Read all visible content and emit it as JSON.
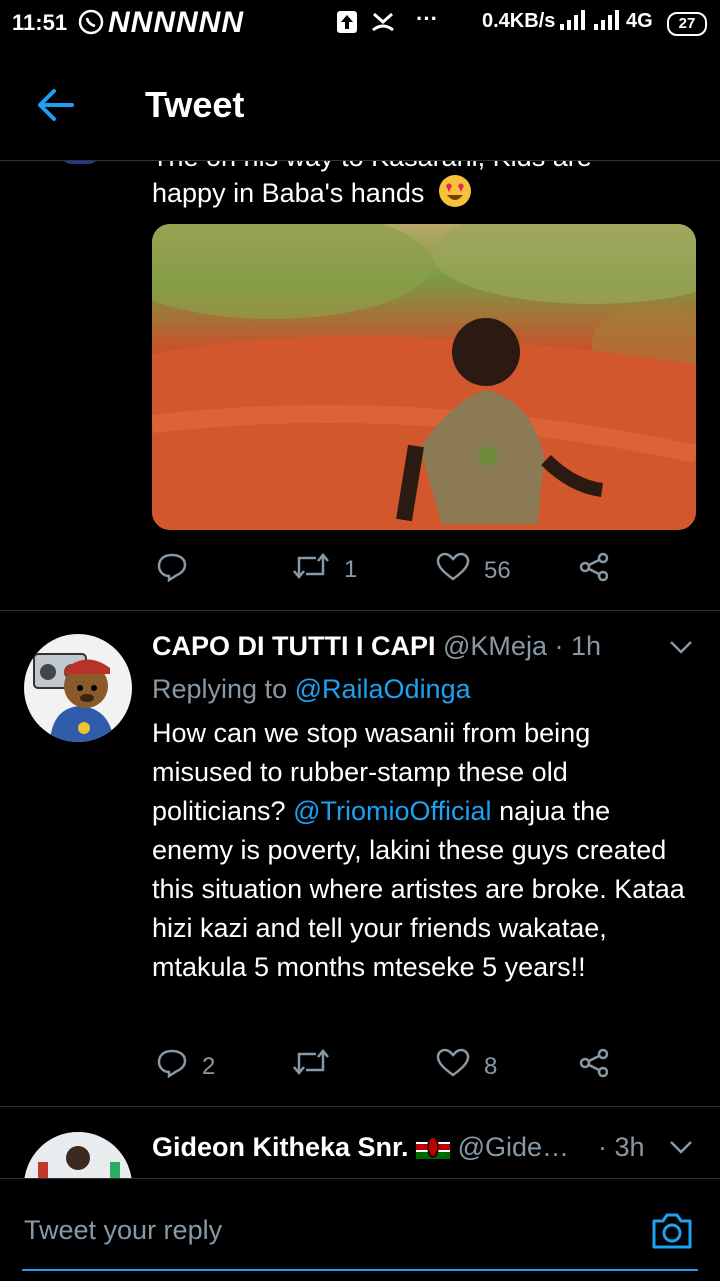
{
  "status_bar": {
    "time": "11:51",
    "notif_text": "NNNNNN",
    "net_speed": "0.4KB/s",
    "network": "4G",
    "battery": "27"
  },
  "header": {
    "title": "Tweet"
  },
  "tweet1": {
    "text_line1": "The on his way to Kasarani, Kids are",
    "text_line2": "happy in Baba's hands",
    "retweets": "1",
    "likes": "56"
  },
  "tweet2": {
    "display_name": "CAPO DI TUTTI I CAPI",
    "handle": "@KMeja",
    "time": "· 1h",
    "replying_prefix": "Replying to",
    "replying_to": "@RailaOdinga",
    "text_a": "How can we stop wasanii from being misused to rubber-stamp these old politicians?",
    "mention": "@TriomioOfficial",
    "text_b": "najua the enemy is poverty, lakini these guys created this situation where artistes are broke. Kataa hizi kazi and tell your friends wakatae, mtakula 5 months mteseke 5 years!!",
    "replies": "2",
    "likes": "8"
  },
  "tweet3": {
    "display_name": "Gideon Kitheka Snr.",
    "handle": "@Gide…",
    "time": "· 3h"
  },
  "reply_bar": {
    "placeholder": "Tweet your reply"
  },
  "colors": {
    "accent": "#1da1f2",
    "muted": "#8899a6",
    "background": "#000000"
  }
}
